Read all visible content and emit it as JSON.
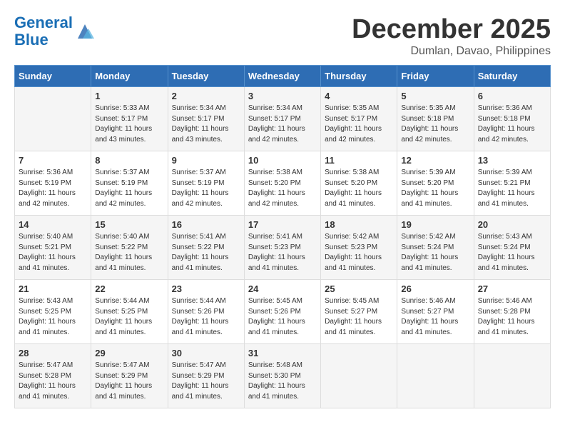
{
  "header": {
    "logo_line1": "General",
    "logo_line2": "Blue",
    "month": "December 2025",
    "location": "Dumlan, Davao, Philippines"
  },
  "weekdays": [
    "Sunday",
    "Monday",
    "Tuesday",
    "Wednesday",
    "Thursday",
    "Friday",
    "Saturday"
  ],
  "weeks": [
    [
      {
        "day": "",
        "info": ""
      },
      {
        "day": "1",
        "info": "Sunrise: 5:33 AM\nSunset: 5:17 PM\nDaylight: 11 hours\nand 43 minutes."
      },
      {
        "day": "2",
        "info": "Sunrise: 5:34 AM\nSunset: 5:17 PM\nDaylight: 11 hours\nand 43 minutes."
      },
      {
        "day": "3",
        "info": "Sunrise: 5:34 AM\nSunset: 5:17 PM\nDaylight: 11 hours\nand 42 minutes."
      },
      {
        "day": "4",
        "info": "Sunrise: 5:35 AM\nSunset: 5:17 PM\nDaylight: 11 hours\nand 42 minutes."
      },
      {
        "day": "5",
        "info": "Sunrise: 5:35 AM\nSunset: 5:18 PM\nDaylight: 11 hours\nand 42 minutes."
      },
      {
        "day": "6",
        "info": "Sunrise: 5:36 AM\nSunset: 5:18 PM\nDaylight: 11 hours\nand 42 minutes."
      }
    ],
    [
      {
        "day": "7",
        "info": "Sunrise: 5:36 AM\nSunset: 5:19 PM\nDaylight: 11 hours\nand 42 minutes."
      },
      {
        "day": "8",
        "info": "Sunrise: 5:37 AM\nSunset: 5:19 PM\nDaylight: 11 hours\nand 42 minutes."
      },
      {
        "day": "9",
        "info": "Sunrise: 5:37 AM\nSunset: 5:19 PM\nDaylight: 11 hours\nand 42 minutes."
      },
      {
        "day": "10",
        "info": "Sunrise: 5:38 AM\nSunset: 5:20 PM\nDaylight: 11 hours\nand 42 minutes."
      },
      {
        "day": "11",
        "info": "Sunrise: 5:38 AM\nSunset: 5:20 PM\nDaylight: 11 hours\nand 41 minutes."
      },
      {
        "day": "12",
        "info": "Sunrise: 5:39 AM\nSunset: 5:20 PM\nDaylight: 11 hours\nand 41 minutes."
      },
      {
        "day": "13",
        "info": "Sunrise: 5:39 AM\nSunset: 5:21 PM\nDaylight: 11 hours\nand 41 minutes."
      }
    ],
    [
      {
        "day": "14",
        "info": "Sunrise: 5:40 AM\nSunset: 5:21 PM\nDaylight: 11 hours\nand 41 minutes."
      },
      {
        "day": "15",
        "info": "Sunrise: 5:40 AM\nSunset: 5:22 PM\nDaylight: 11 hours\nand 41 minutes."
      },
      {
        "day": "16",
        "info": "Sunrise: 5:41 AM\nSunset: 5:22 PM\nDaylight: 11 hours\nand 41 minutes."
      },
      {
        "day": "17",
        "info": "Sunrise: 5:41 AM\nSunset: 5:23 PM\nDaylight: 11 hours\nand 41 minutes."
      },
      {
        "day": "18",
        "info": "Sunrise: 5:42 AM\nSunset: 5:23 PM\nDaylight: 11 hours\nand 41 minutes."
      },
      {
        "day": "19",
        "info": "Sunrise: 5:42 AM\nSunset: 5:24 PM\nDaylight: 11 hours\nand 41 minutes."
      },
      {
        "day": "20",
        "info": "Sunrise: 5:43 AM\nSunset: 5:24 PM\nDaylight: 11 hours\nand 41 minutes."
      }
    ],
    [
      {
        "day": "21",
        "info": "Sunrise: 5:43 AM\nSunset: 5:25 PM\nDaylight: 11 hours\nand 41 minutes."
      },
      {
        "day": "22",
        "info": "Sunrise: 5:44 AM\nSunset: 5:25 PM\nDaylight: 11 hours\nand 41 minutes."
      },
      {
        "day": "23",
        "info": "Sunrise: 5:44 AM\nSunset: 5:26 PM\nDaylight: 11 hours\nand 41 minutes."
      },
      {
        "day": "24",
        "info": "Sunrise: 5:45 AM\nSunset: 5:26 PM\nDaylight: 11 hours\nand 41 minutes."
      },
      {
        "day": "25",
        "info": "Sunrise: 5:45 AM\nSunset: 5:27 PM\nDaylight: 11 hours\nand 41 minutes."
      },
      {
        "day": "26",
        "info": "Sunrise: 5:46 AM\nSunset: 5:27 PM\nDaylight: 11 hours\nand 41 minutes."
      },
      {
        "day": "27",
        "info": "Sunrise: 5:46 AM\nSunset: 5:28 PM\nDaylight: 11 hours\nand 41 minutes."
      }
    ],
    [
      {
        "day": "28",
        "info": "Sunrise: 5:47 AM\nSunset: 5:28 PM\nDaylight: 11 hours\nand 41 minutes."
      },
      {
        "day": "29",
        "info": "Sunrise: 5:47 AM\nSunset: 5:29 PM\nDaylight: 11 hours\nand 41 minutes."
      },
      {
        "day": "30",
        "info": "Sunrise: 5:47 AM\nSunset: 5:29 PM\nDaylight: 11 hours\nand 41 minutes."
      },
      {
        "day": "31",
        "info": "Sunrise: 5:48 AM\nSunset: 5:30 PM\nDaylight: 11 hours\nand 41 minutes."
      },
      {
        "day": "",
        "info": ""
      },
      {
        "day": "",
        "info": ""
      },
      {
        "day": "",
        "info": ""
      }
    ]
  ]
}
